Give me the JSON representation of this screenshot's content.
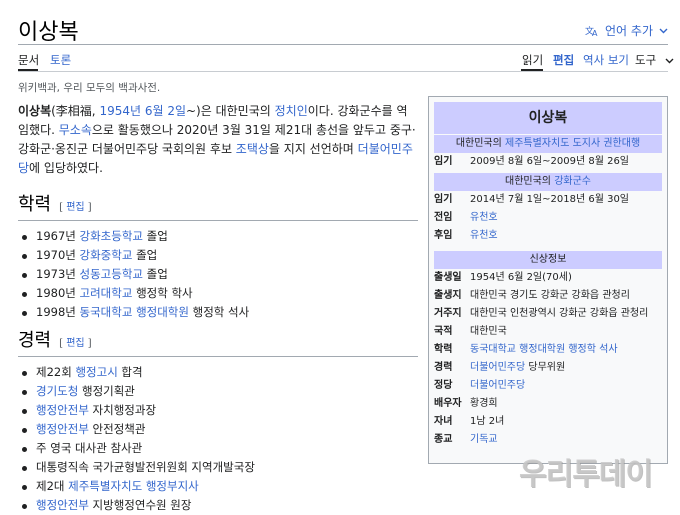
{
  "page": {
    "title": "이상복",
    "lang_button": "언어 추가",
    "tagline": "위키백과, 우리 모두의 백과사전."
  },
  "tabs": {
    "article": "문서",
    "talk": "토론",
    "read": "읽기",
    "edit": "편집",
    "history": "역사 보기",
    "tools": "도구"
  },
  "intro": {
    "name": "이상복",
    "hanja_open": "(李相福, ",
    "birth_link": "1954년 6월 2일",
    "after_birth": "~)은 대한민국의 ",
    "politician_link": "정치인",
    "text_1": "이다. 강화군수를 역임했다. ",
    "independent_link": "무소속",
    "text_2": "으로 활동했으나 2020년 3월 31일 제21대 총선을 앞두고 중구·강화군·옹진군 더불어민주당 국회의원 후보 ",
    "candidate_link": "조택상",
    "text_3": "을 지지 선언하며 ",
    "party_link": "더불어민주당",
    "text_4": "에 입당하였다."
  },
  "edit_label": "편집",
  "education": {
    "heading": "학력",
    "items": [
      {
        "pre": "1967년 ",
        "link": "강화초등학교",
        "post": " 졸업"
      },
      {
        "pre": "1970년 ",
        "link": "강화중학교",
        "post": " 졸업"
      },
      {
        "pre": "1973년 ",
        "link": "성동고등학교",
        "post": " 졸업"
      },
      {
        "pre": "1980년 ",
        "link": "고려대학교",
        "post": " 행정학 학사"
      },
      {
        "pre": "1998년 ",
        "link": "동국대학교 행정대학원",
        "post": " 행정학 석사"
      }
    ]
  },
  "career": {
    "heading": "경력",
    "items": [
      {
        "pre": "제22회 ",
        "link": "행정고시",
        "post": " 합격"
      },
      {
        "pre": "",
        "link": "경기도청",
        "post": " 행정기획관"
      },
      {
        "pre": "",
        "link": "행정안전부",
        "post": " 자치행정과장"
      },
      {
        "pre": "",
        "link": "행정안전부",
        "post": " 안전정책관"
      },
      {
        "pre": "주 영국 대사관 참사관",
        "link": "",
        "post": ""
      },
      {
        "pre": "대통령직속 국가균형발전위원회 지역개발국장",
        "link": "",
        "post": ""
      },
      {
        "pre": "제2대 ",
        "link": "제주특별자치도 행정부지사",
        "post": ""
      },
      {
        "pre": "",
        "link": "행정안전부",
        "post": " 지방행정연수원 원장"
      }
    ]
  },
  "infobox": {
    "title": "이상복",
    "sub1_pre": "대한민국의 ",
    "sub1_link": "제주특별자치도 도지사 권한대행",
    "term1_key": "임기",
    "term1_val": "2009년 8월 6일~2009년 8월 26일",
    "sub2_pre": "대한민국의 ",
    "sub2_link": "강화군수",
    "term2_key": "임기",
    "term2_val": "2014년 7월 1일~2018년 6월 30일",
    "prev_key": "전임",
    "prev_val": "유천호",
    "next_key": "후임",
    "next_val": "유천호",
    "personal_header": "신상정보",
    "birth_key": "출생일",
    "birth_val": "1954년 6월 2일(70세)",
    "birthplace_key": "출생지",
    "birthplace_val": "대한민국 경기도 강화군 강화읍 관청리",
    "residence_key": "거주지",
    "residence_val": "대한민국 인천광역시 강화군 강화읍 관청리",
    "nationality_key": "국적",
    "nationality_val": "대한민국",
    "alma_key": "학력",
    "alma_val": "동국대학교 행정대학원 행정학 석사",
    "career_key": "경력",
    "career_link": "더불어민주당",
    "career_post": " 당무위원",
    "party_key": "정당",
    "party_val": "더불어민주당",
    "spouse_key": "배우자",
    "spouse_val": "황경희",
    "children_key": "자녀",
    "children_val": "1남 2녀",
    "religion_key": "종교",
    "religion_val": "기독교"
  },
  "watermark": "우리투데이",
  "colors": {
    "link": "#3366cc",
    "infobox_header": "#ccccff",
    "infobox_bg": "#f8f9fa"
  },
  "icons": {
    "translate": "translate-icon",
    "chevron": "chevron-down-icon"
  }
}
